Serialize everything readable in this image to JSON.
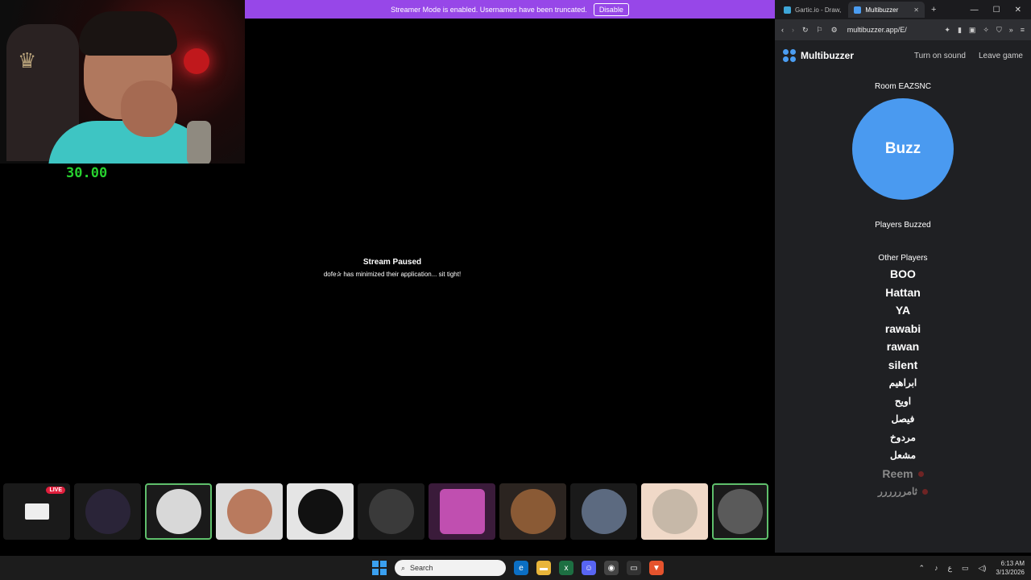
{
  "banner": {
    "text": "Streamer Mode is enabled. Usernames have been truncated.",
    "disable_label": "Disable"
  },
  "webcam": {
    "timer": "30.00"
  },
  "stream": {
    "title": "Stream Paused",
    "message": "dofe✰ has minimized their application... sit tight!"
  },
  "strip": {
    "live_label": "LIVE"
  },
  "browser": {
    "tabs": [
      {
        "title": "Gartic.io - Draw, ",
        "active": false
      },
      {
        "title": "Multibuzzer",
        "active": true
      }
    ],
    "url": "multibuzzer.app/E/"
  },
  "multibuzzer": {
    "brand": "Multibuzzer",
    "sound_label": "Turn on sound",
    "leave_label": "Leave game",
    "room": "Room EAZSNC",
    "buzz_label": "Buzz",
    "players_buzzed_label": "Players Buzzed",
    "other_players_label": "Other Players",
    "players": [
      "BOO",
      "Hattan",
      "YA",
      "rawabi",
      "rawan",
      "silent",
      "ابراهيم",
      "اويح",
      "فيصل",
      "مردوخ",
      "مشعل",
      "Reem",
      "ثامرررررر"
    ]
  },
  "taskbar": {
    "search_placeholder": "Search",
    "time": "6:13 AM",
    "date": "3/13/2026",
    "lang": "ع"
  },
  "colors": {
    "accent": "#4a9af0",
    "banner": "#9747e8",
    "timer": "#27d12f"
  }
}
